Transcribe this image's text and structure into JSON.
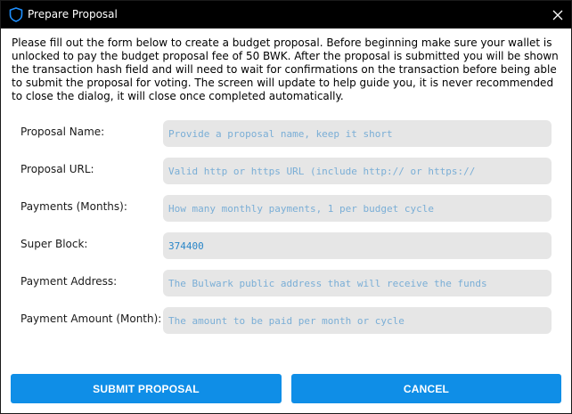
{
  "window": {
    "title": "Prepare Proposal",
    "icon": "shield-icon",
    "close_icon": "close-icon"
  },
  "intro_text": "Please fill out the form below to create a budget proposal.  Before beginning make sure your wallet is unlocked to pay the budget proposal fee of 50 BWK.  After the proposal is submitted you will be shown the transaction hash field and will need to wait for confirmations on the transaction before being able to submit the proposal for voting.  The screen will update to help guide you, it is never recommended to close the dialog, it will close once completed automatically.",
  "fields": [
    {
      "label": "Proposal Name:",
      "value": "",
      "placeholder": "Provide a proposal name, keep it short"
    },
    {
      "label": "Proposal URL:",
      "value": "",
      "placeholder": "Valid http or https URL (include http:// or https://"
    },
    {
      "label": "Payments (Months):",
      "value": "",
      "placeholder": "How many monthly payments, 1 per budget cycle"
    },
    {
      "label": "Super Block:",
      "value": "374400",
      "placeholder": ""
    },
    {
      "label": "Payment Address:",
      "value": "",
      "placeholder": "The Bulwark public address that will receive the funds"
    },
    {
      "label": "Payment Amount (Month):",
      "value": "",
      "placeholder": "The amount to be paid per month or cycle"
    }
  ],
  "buttons": {
    "submit_label": "SUBMIT PROPOSAL",
    "cancel_label": "CANCEL"
  },
  "colors": {
    "accent": "#0f8ee7",
    "field_bg": "#e6e6e6",
    "field_text": "#2a86c8",
    "titlebar_bg": "#000000"
  }
}
